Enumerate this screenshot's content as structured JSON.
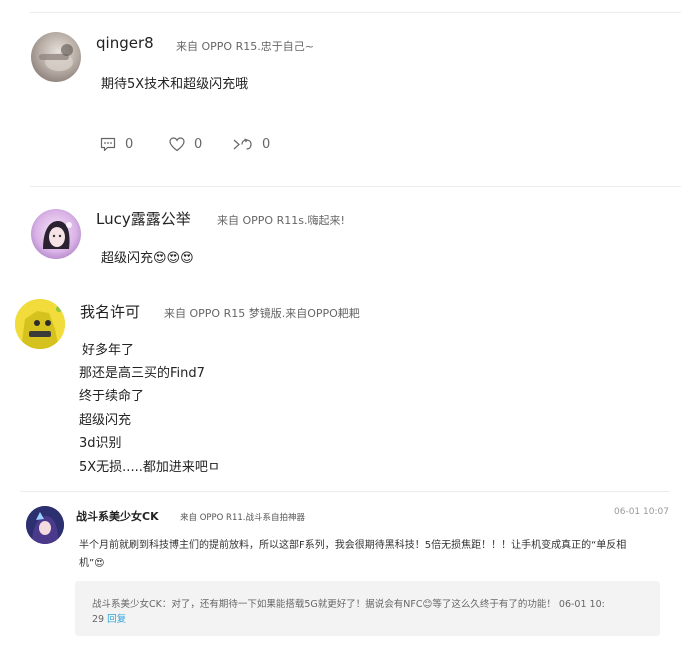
{
  "comments": [
    {
      "username": "qinger8",
      "source": "来自 OPPO R15.忠于自己~",
      "text": "期待5X技术和超级闪充哦",
      "actions": {
        "comment_count": "0",
        "like_count": "0",
        "share_count": "0"
      }
    },
    {
      "username": "Lucy露露公举",
      "source": "来自 OPPO R11s.嗨起来!",
      "text": "超级闪充😍😍😍"
    },
    {
      "username": "我名许可",
      "source": "来自 OPPO R15 梦镜版.来自OPPO耙耙",
      "lines": [
        "好多年了",
        "那还是高三买的Find7",
        "终于续命了",
        "超级闪充",
        "3d识别",
        "5X无损.....都加进来吧ㅁ"
      ]
    },
    {
      "username": "战斗系美少女CK",
      "source": "来自 OPPO R11.战斗系自拍神器",
      "timestamp": "06-01 10:07",
      "text_line1": "半个月前就刷到科技博主们的提前放料，所以这部F系列，我会很期待黑科技！5倍无损焦距！！！让手机变成真正的“单反相",
      "text_line2": "机”😍",
      "reply": {
        "line1": "战斗系美少女CK：对了，还有期待一下如果能搭载5G就更好了！据说会有NFC😊等了这么久终于有了的功能！ 06-01 10:",
        "line2_prefix": "29",
        "reply_label": "回复"
      }
    }
  ],
  "colors": {
    "link": "#2fa4d8",
    "divider": "#ececec",
    "reply_bg": "#f3f3f3"
  }
}
